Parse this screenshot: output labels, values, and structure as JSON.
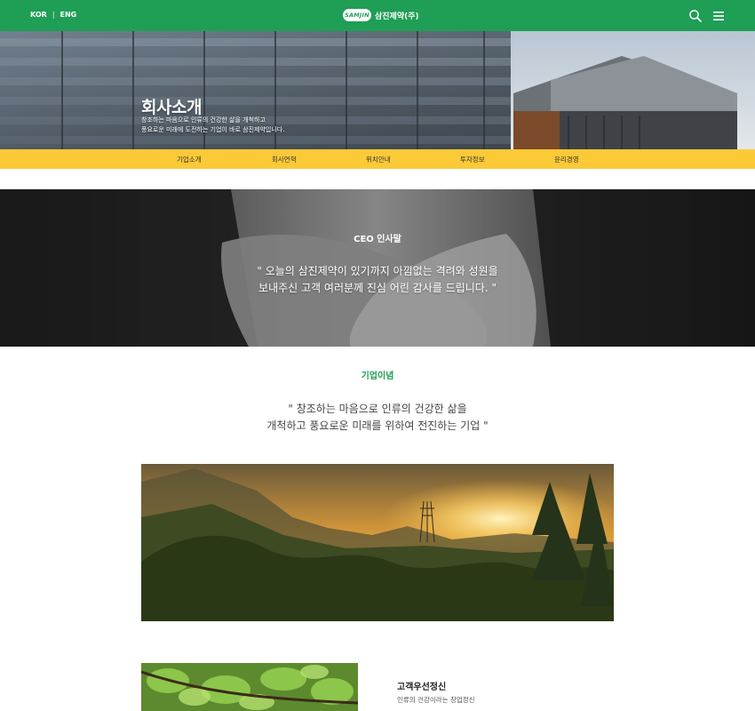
{
  "header": {
    "lang_kor": "KOR",
    "lang_sep": "|",
    "lang_eng": "ENG",
    "logo_badge": "SAMJIN",
    "logo_name": "삼진제약(주)",
    "brand_color": "#1f9e55"
  },
  "hero": {
    "title": "회사소개",
    "subtitle_line1": "창조하는 마음으로 인류의 건강한 삶을 개척하고",
    "subtitle_line2": "풍요로운 미래에 도전하는 기업이 바로 삼진제약입니다."
  },
  "subnav": {
    "color": "#fcc937",
    "items": [
      "기업소개",
      "회사연혁",
      "위치안내",
      "투자정보",
      "윤리경영"
    ]
  },
  "ceo": {
    "label": "CEO 인사말",
    "quote_line1": "\" 오늘의 삼진제약이 있기까지 아낌없는 격려와 성원을",
    "quote_line2": "보내주신 고객 여러분께 진심 어린 감사를 드립니다. \""
  },
  "philosophy": {
    "label": "기업이념",
    "quote_line1": "\" 창조하는 마음으로 인류의 건강한 삶을",
    "quote_line2": "개척하고 풍요로운 미래를 위하여 전진하는 기업 \""
  },
  "customer_spirit": {
    "title": "고객우선정신",
    "desc": "인류의 건강이라는 창업정신"
  },
  "icons": {
    "search": "search-icon",
    "menu": "hamburger-menu-icon"
  }
}
